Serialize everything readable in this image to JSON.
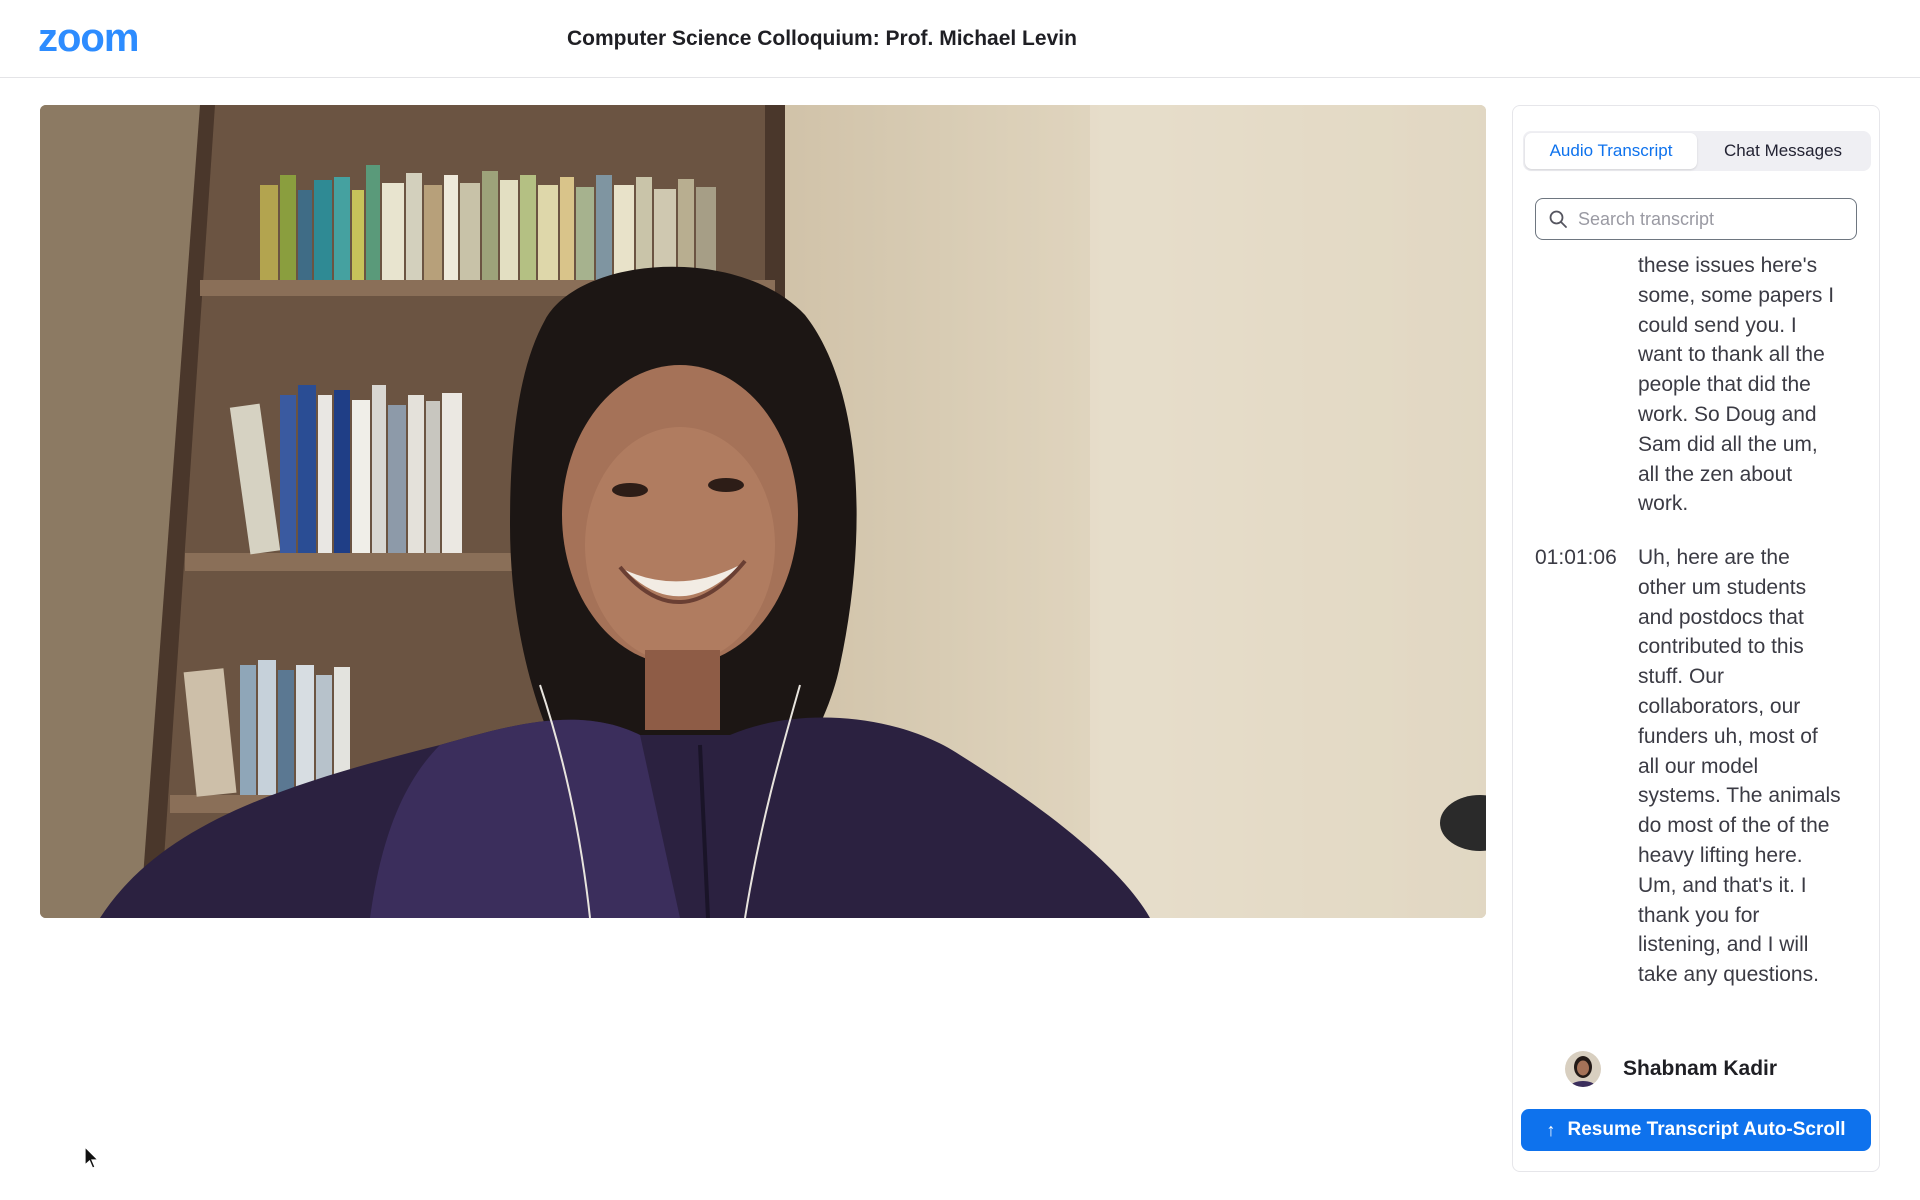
{
  "app": {
    "logo_text": "zoom",
    "meeting_title": "Computer Science Colloquium: Prof. Michael Levin",
    "brand_color": "#2d8cff"
  },
  "video": {
    "description_icon": "participant-video-feed"
  },
  "panel": {
    "tabs": [
      {
        "label": "Audio Transcript",
        "active": true
      },
      {
        "label": "Chat Messages",
        "active": false
      }
    ],
    "search": {
      "placeholder": "Search transcript",
      "value": ""
    },
    "transcript": [
      {
        "time": "",
        "text": "these issues here's some, some papers I could send you. I want to thank all the people that did the work. So Doug and Sam did all the um, all the zen about work."
      },
      {
        "time": "01:01:06",
        "text": "Uh, here are the other um students and postdocs that contributed to this stuff. Our collaborators, our funders uh, most of all our model systems. The animals do most of the of the heavy lifting here. Um, and that's it. I thank you for listening, and I will take any questions."
      }
    ],
    "speaker": {
      "name": "Shabnam Kadir"
    },
    "resume_button": {
      "label": "Resume Transcript Auto-Scroll",
      "icon": "arrow-up-icon",
      "color": "#0e72ed"
    }
  }
}
